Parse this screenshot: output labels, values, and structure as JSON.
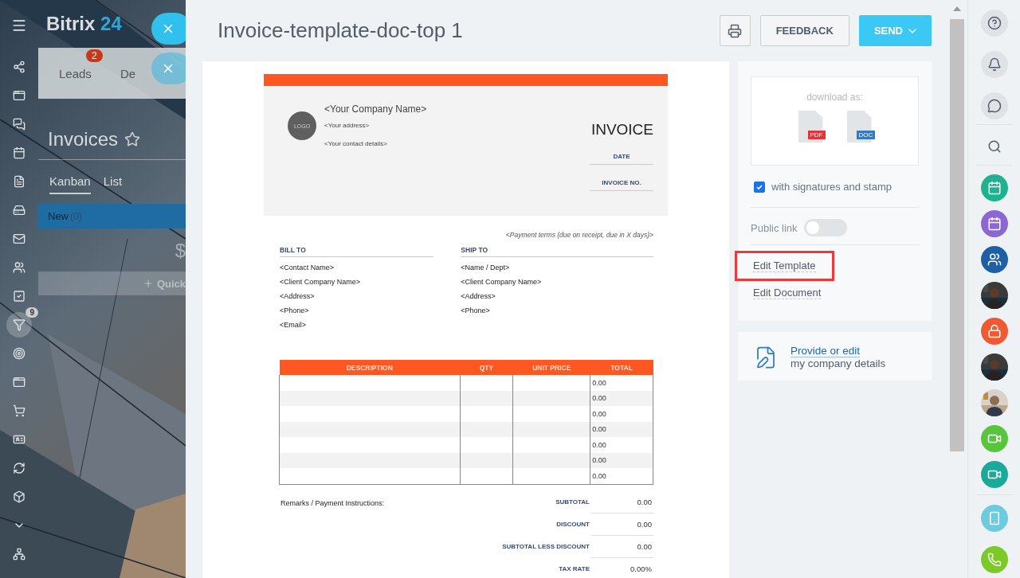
{
  "background": {
    "logo": {
      "name": "Bitrix",
      "suffix": "24"
    },
    "tabs": [
      {
        "label": "Leads",
        "badge": "2"
      },
      {
        "label": "De"
      }
    ],
    "title": "Invoices",
    "views": [
      {
        "label": "Kanban",
        "selected": true
      },
      {
        "label": "List",
        "selected": false
      }
    ],
    "column": {
      "title": "New",
      "count": "(0)",
      "amount": "$",
      "quick_add": "Quick"
    }
  },
  "left_menu": {
    "items": [
      {
        "kind": "nodes"
      },
      {
        "kind": "window"
      },
      {
        "kind": "chat"
      },
      {
        "kind": "calendar"
      },
      {
        "kind": "doc"
      },
      {
        "kind": "drive"
      },
      {
        "kind": "mail"
      },
      {
        "kind": "people"
      },
      {
        "kind": "task"
      },
      {
        "kind": "funnel",
        "badge": "9",
        "selected": true
      },
      {
        "kind": "target"
      },
      {
        "kind": "browser"
      },
      {
        "kind": "cart"
      },
      {
        "kind": "card"
      },
      {
        "kind": "sync"
      },
      {
        "kind": "box"
      },
      {
        "kind": "more"
      },
      {
        "kind": "tree"
      }
    ]
  },
  "slider": {
    "title": "Invoice-template-doc-top 1",
    "buttons": [
      {
        "kind": "print"
      },
      {
        "kind": "outline",
        "label": "FEEDBACK"
      },
      {
        "kind": "primary",
        "label": "SEND"
      }
    ]
  },
  "document": {
    "company": {
      "logo": "LOGO",
      "name": "<Your Company Name>",
      "address": "<Your address>",
      "contact": "<Your contact details>"
    },
    "heading": "INVOICE",
    "fields": [
      "DATE",
      "INVOICE NO."
    ],
    "payment_terms": "<Payment terms (due on receipt, due in X days)>",
    "bill_to": {
      "title": "BILL TO",
      "lines": [
        "<Contact Name>",
        "<Client Company Name>",
        "<Address>",
        "<Phone>",
        "<Email>"
      ]
    },
    "ship_to": {
      "title": "SHIP TO",
      "lines": [
        "<Name / Dept>",
        "<Client Company Name>",
        "<Address>",
        "<Phone>"
      ]
    },
    "table": {
      "columns": [
        "DESCRIPTION",
        "QTY",
        "UNIT PRICE",
        "TOTAL"
      ],
      "rows": [
        {
          "total": "0.00"
        },
        {
          "total": "0.00"
        },
        {
          "total": "0.00"
        },
        {
          "total": "0.00"
        },
        {
          "total": "0.00"
        },
        {
          "total": "0.00"
        },
        {
          "total": "0.00"
        }
      ]
    },
    "remarks": "Remarks / Payment Instructions:",
    "summary": [
      {
        "label": "SUBTOTAL",
        "value": "0.00"
      },
      {
        "label": "DISCOUNT",
        "value": "0.00"
      },
      {
        "label": "SUBTOTAL LESS DISCOUNT",
        "value": "0.00"
      },
      {
        "label": "TAX RATE",
        "value": "0.00%"
      }
    ]
  },
  "sidebar": {
    "download": {
      "label": "download as:",
      "formats": [
        {
          "label": "PDF",
          "color": "#e0353d"
        },
        {
          "label": "DOC",
          "color": "#2f7cc0"
        }
      ]
    },
    "signatures": {
      "label": "with signatures and stamp",
      "checked": true
    },
    "public_link": {
      "label": "Public link",
      "on": false
    },
    "links": [
      {
        "label": "Edit Template",
        "highlighted": true
      },
      {
        "label": "Edit Document",
        "highlighted": false
      }
    ],
    "company": {
      "link": "Provide or edit",
      "text": "my company details"
    }
  },
  "right_rail": {
    "items": [
      {
        "kind": "help"
      },
      {
        "kind": "bell"
      },
      {
        "kind": "chat"
      },
      {
        "kind": "search"
      },
      {
        "kind": "calendar",
        "color": "#1fb28e"
      },
      {
        "kind": "calendar",
        "color": "#8d67d1"
      },
      {
        "kind": "group",
        "color": "#1e5fa6"
      },
      {
        "kind": "picture"
      },
      {
        "kind": "lock",
        "color": "#ed5a34"
      },
      {
        "kind": "picture"
      },
      {
        "kind": "picture"
      },
      {
        "kind": "video",
        "color": "#58c53d"
      },
      {
        "kind": "video",
        "color": "#1ba99a"
      }
    ],
    "bottom": [
      {
        "kind": "phone-cloud",
        "color": "#6dcbe0"
      },
      {
        "kind": "call",
        "color": "#7dc928"
      }
    ]
  }
}
